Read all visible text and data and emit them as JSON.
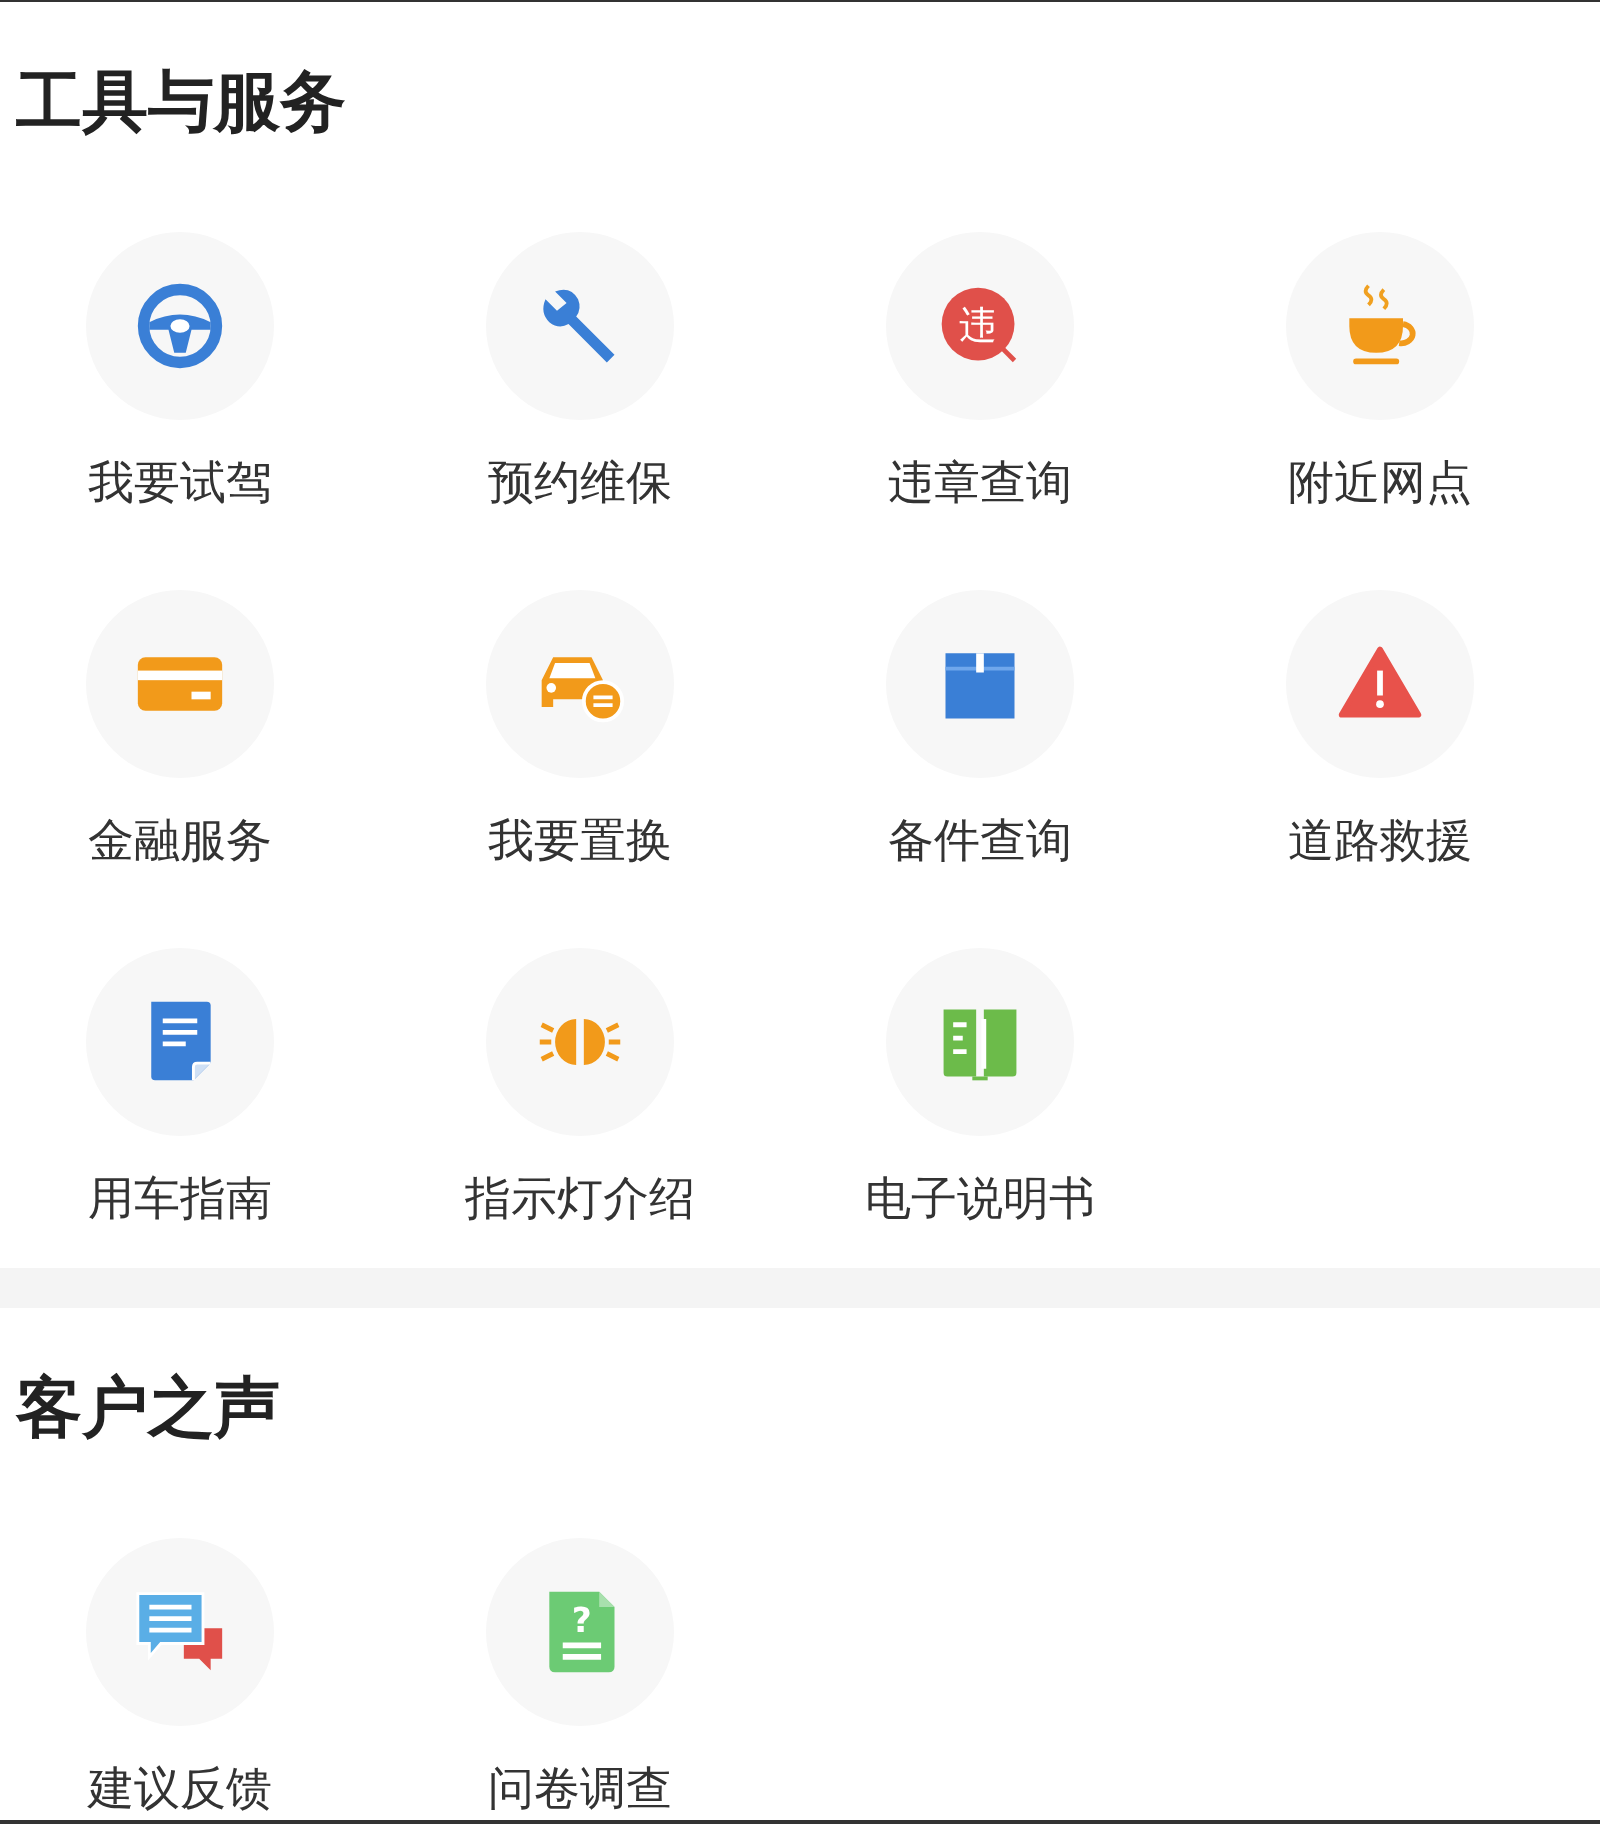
{
  "sections": [
    {
      "title": "工具与服务",
      "items": [
        {
          "label": "我要试驾",
          "kind": "steering"
        },
        {
          "label": "预约维保",
          "kind": "wrench"
        },
        {
          "label": "违章查询",
          "kind": "violation",
          "icon_text": "违"
        },
        {
          "label": "附近网点",
          "kind": "coffee"
        },
        {
          "label": "金融服务",
          "kind": "card"
        },
        {
          "label": "我要置换",
          "kind": "car_swap"
        },
        {
          "label": "备件查询",
          "kind": "box"
        },
        {
          "label": "道路救援",
          "kind": "warning"
        },
        {
          "label": "用车指南",
          "kind": "document"
        },
        {
          "label": "指示灯介绍",
          "kind": "lights"
        },
        {
          "label": "电子说明书",
          "kind": "book"
        }
      ]
    },
    {
      "title": "客户之声",
      "items": [
        {
          "label": "建议反馈",
          "kind": "chat"
        },
        {
          "label": "问卷调查",
          "kind": "survey",
          "icon_text": "?"
        }
      ]
    }
  ]
}
